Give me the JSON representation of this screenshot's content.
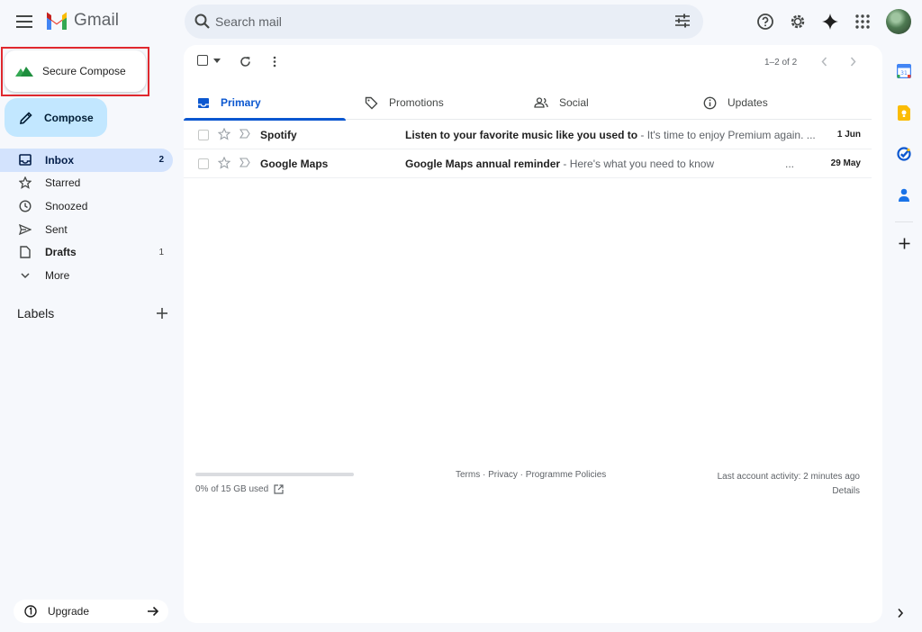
{
  "header": {
    "app_name": "Gmail",
    "search_placeholder": "Search mail",
    "icons": [
      "menu-icon",
      "search-icon",
      "filter-icon",
      "help-icon",
      "settings-icon",
      "gemini-icon",
      "apps-icon"
    ],
    "brand_colors": {
      "red": "#ea4335",
      "blue": "#4285f4",
      "green": "#34a853",
      "yellow": "#fbbc04"
    }
  },
  "sidebar": {
    "secure_compose_label": "Secure Compose",
    "compose_label": "Compose",
    "items": [
      {
        "label": "Inbox",
        "count": "2",
        "icon": "inbox-icon"
      },
      {
        "label": "Starred",
        "count": "",
        "icon": "star-icon"
      },
      {
        "label": "Snoozed",
        "count": "",
        "icon": "clock-icon"
      },
      {
        "label": "Sent",
        "count": "",
        "icon": "send-icon"
      },
      {
        "label": "Drafts",
        "count": "1",
        "icon": "draft-icon"
      },
      {
        "label": "More",
        "count": "",
        "icon": "chevron-down-icon"
      }
    ],
    "labels_heading": "Labels",
    "upgrade_label": "Upgrade"
  },
  "toolbar": {
    "pagination": "1–2 of 2"
  },
  "tabs": [
    {
      "label": "Primary",
      "icon": "inbox-icon",
      "active": true
    },
    {
      "label": "Promotions",
      "icon": "tag-icon",
      "active": false
    },
    {
      "label": "Social",
      "icon": "people-icon",
      "active": false
    },
    {
      "label": "Updates",
      "icon": "info-icon",
      "active": false
    }
  ],
  "emails": [
    {
      "sender": "Spotify",
      "subject": "Listen to your favorite music like you used to",
      "snippet": " - It's time to enjoy Premium again. ...",
      "date": "1 Jun"
    },
    {
      "sender": "Google Maps",
      "subject": "Google Maps annual reminder",
      "snippet": " - Here's what you need to know",
      "ellipsis": "...",
      "date": "29 May"
    }
  ],
  "footer": {
    "storage": "0% of 15 GB used",
    "policies": "Terms · Privacy · Programme Policies",
    "last_activity": "Last account activity: 2 minutes ago",
    "details": "Details"
  },
  "side_panel": [
    "calendar-icon",
    "keep-icon",
    "tasks-icon",
    "contacts-icon",
    "add-icon"
  ]
}
